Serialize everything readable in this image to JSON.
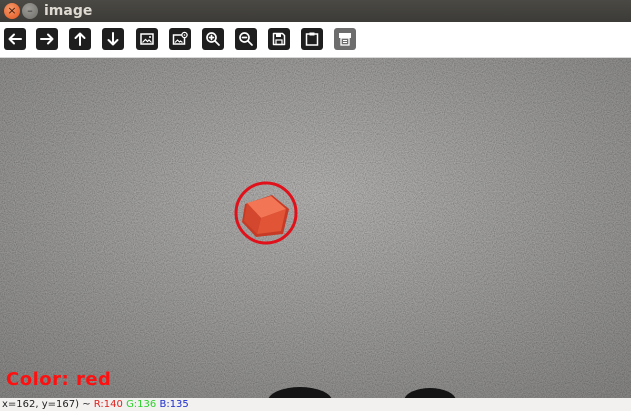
{
  "window": {
    "title": "image",
    "close_glyph": "×",
    "minimize_glyph": "–"
  },
  "toolbar": {
    "buttons": [
      {
        "icon": "arrow-left-icon"
      },
      {
        "icon": "arrow-right-icon"
      },
      {
        "icon": "arrow-up-icon"
      },
      {
        "icon": "arrow-down-icon"
      },
      {
        "icon": "image-icon"
      },
      {
        "icon": "image-settings-icon"
      },
      {
        "icon": "zoom-in-icon"
      },
      {
        "icon": "zoom-out-icon"
      },
      {
        "icon": "save-icon"
      },
      {
        "icon": "clipboard-icon"
      },
      {
        "icon": "properties-icon"
      }
    ]
  },
  "image": {
    "overlay_label": "Color: red",
    "overlay_color": "#ff1010",
    "detection_circle_color": "#e0111a",
    "object_color": "#e8553d"
  },
  "status": {
    "coords": "x=162, y=167) ~ ",
    "r_label": "R:140",
    "g_label": "G:136",
    "b_label": "B:135",
    "r_color": "#e0201b",
    "g_color": "#2bd22b",
    "b_color": "#1c2ccf"
  }
}
